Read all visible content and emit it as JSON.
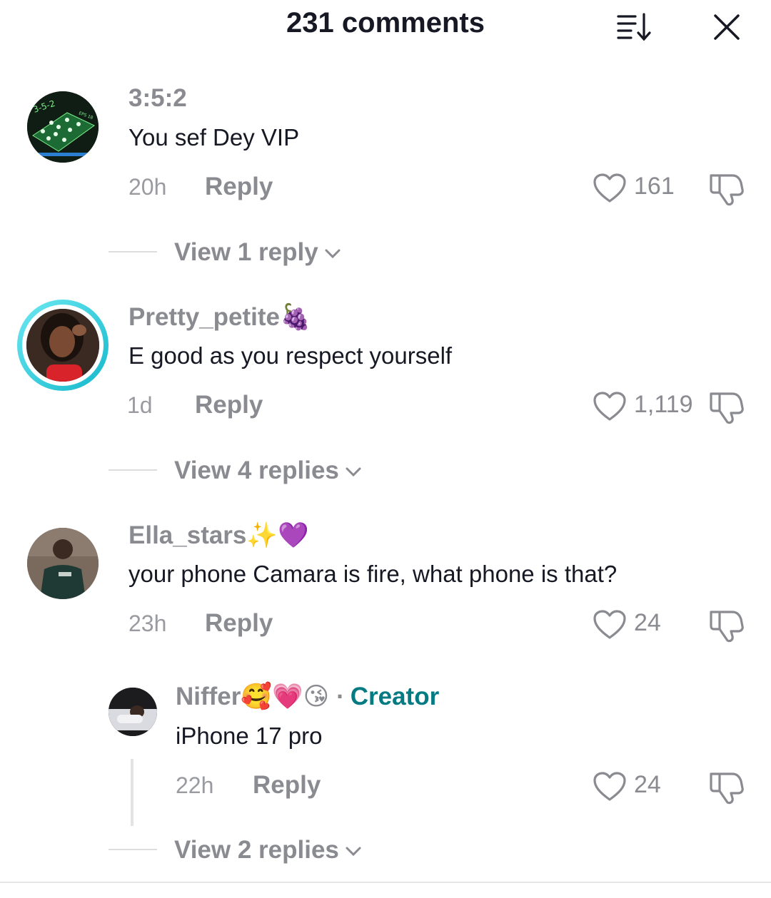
{
  "header": {
    "title": "231 comments"
  },
  "comments": [
    {
      "username": "3:5:2",
      "username_emoji": "",
      "text": "You sef Dey VIP",
      "time": "20h",
      "reply_label": "Reply",
      "likes": "161",
      "view_replies": "View 1 reply",
      "avatar_text_1": "3-5-2",
      "avatar_text_2": "EPS 18"
    },
    {
      "username": "Pretty_petite",
      "username_emoji": "🍇",
      "text": "E good as you respect yourself",
      "time": "1d",
      "reply_label": "Reply",
      "likes": "1,119",
      "view_replies": "View 4 replies"
    },
    {
      "username": "Ella_stars",
      "username_emoji": "✨💜",
      "text": "your phone Camara is fire, what phone is that?",
      "time": "23h",
      "reply_label": "Reply",
      "likes": "24"
    }
  ],
  "reply": {
    "username": "Niffer",
    "username_emoji": "🥰💗😘",
    "separator": "·",
    "badge": "Creator",
    "text": "iPhone 17 pro",
    "time": "22h",
    "reply_label": "Reply",
    "likes": "24",
    "view_replies": "View 2 replies"
  },
  "colors": {
    "creator": "#047b82",
    "story_ring": "#2fd1e0",
    "muted": "#8a8b91"
  },
  "icons": [
    "sort-icon",
    "close-icon",
    "heart-icon",
    "dislike-icon",
    "chevron-down-icon"
  ]
}
